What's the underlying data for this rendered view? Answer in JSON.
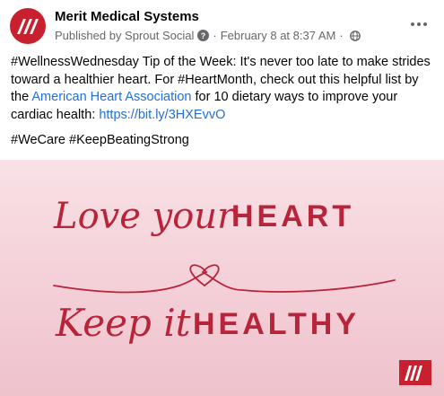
{
  "post": {
    "page_name": "Merit Medical Systems",
    "published_by": "Published by Sprout Social",
    "date": "February 8 at 8:37 AM",
    "separator": "·",
    "text": {
      "p1_part1": "#WellnessWednesday Tip of the Week: It's never too late to make strides toward a healthier heart. For #HeartMonth, check out this helpful list by the ",
      "p1_link": "American Heart Association",
      "p1_part2": " for 10 dietary ways to improve your cardiac health: ",
      "p1_url": "https://bit.ly/3HXEvvO",
      "p2": "#WeCare #KeepBeatingStrong"
    }
  },
  "image": {
    "line1_script": "Love your",
    "line1_caps": "HEART",
    "line2_script": "Keep it",
    "line2_caps": "HEALTHY"
  },
  "colors": {
    "brand_red": "#c8202f",
    "link_blue": "#216fdb",
    "image_pink": "#f4cfd7"
  },
  "icons": {
    "more": "more-horizontal-icon",
    "info": "info-circle-icon",
    "audience": "globe-icon",
    "avatar": "merit-logo-icon"
  }
}
